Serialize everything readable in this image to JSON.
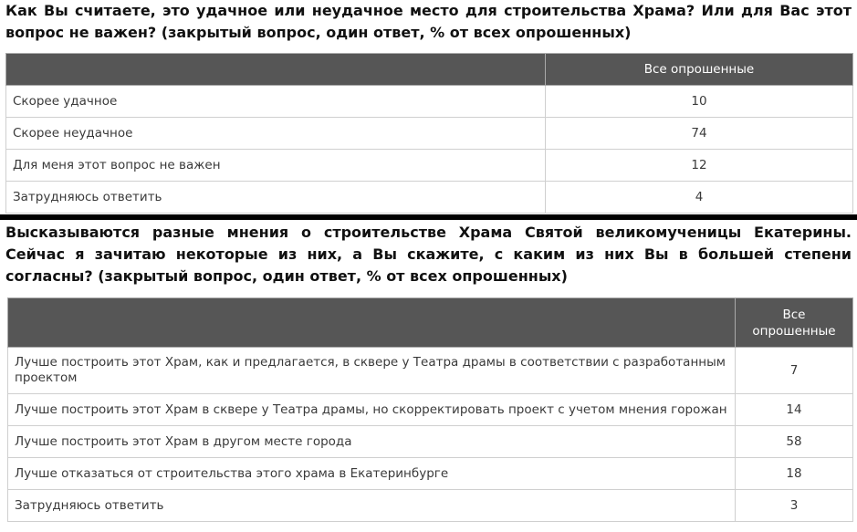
{
  "question1": {
    "text": "Как Вы считаете, это удачное или неудачное место для строительства Храма? Или для Вас этот вопрос не важен? (закрытый вопрос, один ответ, % от всех опрошенных)",
    "column_header": "Все опрошенные",
    "rows": [
      {
        "label": "Скорее удачное",
        "value": "10"
      },
      {
        "label": "Скорее неудачное",
        "value": "74"
      },
      {
        "label": "Для меня этот вопрос не важен",
        "value": "12"
      },
      {
        "label": "Затрудняюсь ответить",
        "value": "4"
      }
    ]
  },
  "question2": {
    "text": "Высказываются разные мнения о строительстве Храма Святой великомученицы Екатерины. Сейчас я зачитаю некоторые из них, а Вы скажите, с каким из них Вы в большей степени согласны? (закрытый вопрос, один ответ, % от всех опрошенных)",
    "column_header": "Все опрошенные",
    "rows": [
      {
        "label": "Лучше построить этот Храм, как и предлагается, в сквере у Театра драмы в соответствии с разработанным проектом",
        "value": "7"
      },
      {
        "label": "Лучше построить этот Храм в сквере у Театра драмы, но скорректировать проект с учетом мнения горожан",
        "value": "14"
      },
      {
        "label": "Лучше построить этот Храм в другом месте города",
        "value": "58"
      },
      {
        "label": "Лучше отказаться от строительства этого храма в Екатеринбурге",
        "value": "18"
      },
      {
        "label": "Затрудняюсь ответить",
        "value": "3"
      }
    ]
  }
}
